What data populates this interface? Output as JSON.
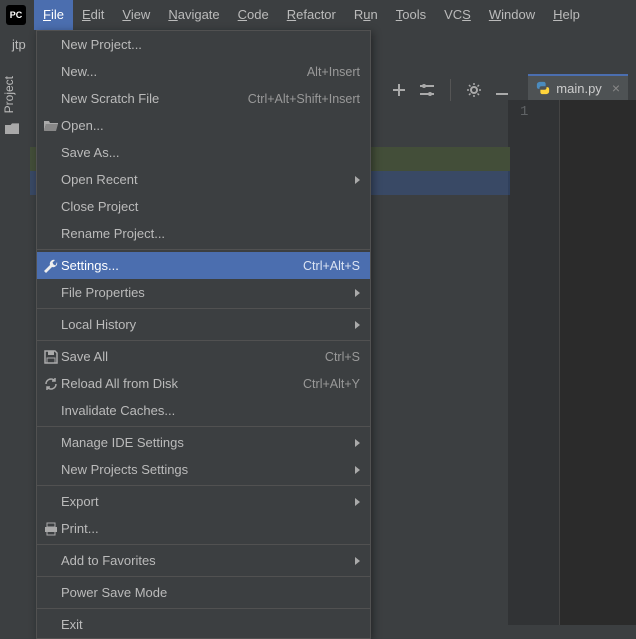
{
  "menubar": {
    "items": [
      {
        "label": "File",
        "mnemonic": "F"
      },
      {
        "label": "Edit",
        "mnemonic": "E"
      },
      {
        "label": "View",
        "mnemonic": "V"
      },
      {
        "label": "Navigate",
        "mnemonic": "N"
      },
      {
        "label": "Code",
        "mnemonic": "C"
      },
      {
        "label": "Refactor",
        "mnemonic": "R"
      },
      {
        "label": "Run",
        "mnemonic": "u"
      },
      {
        "label": "Tools",
        "mnemonic": "T"
      },
      {
        "label": "VCS",
        "mnemonic": "S"
      },
      {
        "label": "Window",
        "mnemonic": "W"
      },
      {
        "label": "Help",
        "mnemonic": "H"
      }
    ]
  },
  "breadcrumb": {
    "project": "jtp"
  },
  "side_tab": {
    "label": "Project"
  },
  "file_menu": {
    "items": [
      {
        "label": "New Project...",
        "shortcut": "",
        "submenu": false,
        "icon": ""
      },
      {
        "label": "New...",
        "mnemonic": "N",
        "shortcut": "Alt+Insert",
        "submenu": false,
        "icon": ""
      },
      {
        "label": "New Scratch File",
        "shortcut": "Ctrl+Alt+Shift+Insert",
        "submenu": false,
        "icon": ""
      },
      {
        "label": "Open...",
        "mnemonic": "O",
        "shortcut": "",
        "submenu": false,
        "icon": "open"
      },
      {
        "label": "Save As...",
        "shortcut": "",
        "submenu": false,
        "icon": ""
      },
      {
        "label": "Open Recent",
        "mnemonic": "R",
        "shortcut": "",
        "submenu": true,
        "icon": ""
      },
      {
        "label": "Close Project",
        "shortcut": "",
        "submenu": false,
        "icon": ""
      },
      {
        "label": "Rename Project...",
        "shortcut": "",
        "submenu": false,
        "icon": ""
      },
      {
        "sep": true
      },
      {
        "label": "Settings...",
        "shortcut": "Ctrl+Alt+S",
        "submenu": false,
        "icon": "wrench",
        "selected": true
      },
      {
        "label": "File Properties",
        "shortcut": "",
        "submenu": true,
        "icon": ""
      },
      {
        "sep": true
      },
      {
        "label": "Local History",
        "mnemonic": "H",
        "shortcut": "",
        "submenu": true,
        "icon": ""
      },
      {
        "sep": true
      },
      {
        "label": "Save All",
        "mnemonic": "S",
        "shortcut": "Ctrl+S",
        "submenu": false,
        "icon": "save"
      },
      {
        "label": "Reload All from Disk",
        "mnemonic": "e",
        "shortcut": "Ctrl+Alt+Y",
        "submenu": false,
        "icon": "reload"
      },
      {
        "label": "Invalidate Caches...",
        "shortcut": "",
        "submenu": false,
        "icon": ""
      },
      {
        "sep": true
      },
      {
        "label": "Manage IDE Settings",
        "shortcut": "",
        "submenu": true,
        "icon": ""
      },
      {
        "label": "New Projects Settings",
        "shortcut": "",
        "submenu": true,
        "icon": ""
      },
      {
        "sep": true
      },
      {
        "label": "Export",
        "shortcut": "",
        "submenu": true,
        "icon": ""
      },
      {
        "label": "Print...",
        "mnemonic": "P",
        "shortcut": "",
        "submenu": false,
        "icon": "print"
      },
      {
        "sep": true
      },
      {
        "label": "Add to Favorites",
        "mnemonic": "F",
        "shortcut": "",
        "submenu": true,
        "icon": ""
      },
      {
        "sep": true
      },
      {
        "label": "Power Save Mode",
        "shortcut": "",
        "submenu": false,
        "icon": ""
      },
      {
        "sep": true
      },
      {
        "label": "Exit",
        "mnemonic": "x",
        "shortcut": "",
        "submenu": false,
        "icon": ""
      }
    ]
  },
  "editor": {
    "tab_label": "main.py",
    "gutter_lines": [
      "1"
    ]
  },
  "app": {
    "icon_label": "PC"
  }
}
